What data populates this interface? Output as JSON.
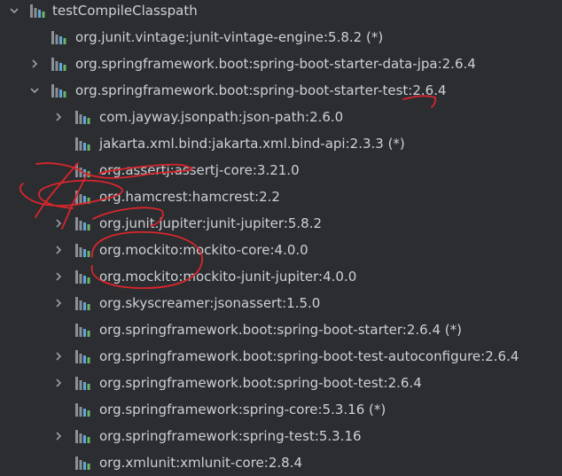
{
  "tree": {
    "root": {
      "label": "testCompileClasspath",
      "icon": "library-icon"
    },
    "items": [
      {
        "label": "org.junit.vintage:junit-vintage-engine:5.8.2 (*)",
        "expandable": false,
        "depth": 1
      },
      {
        "label": "org.springframework.boot:spring-boot-starter-data-jpa:2.6.4",
        "expandable": true,
        "expanded": false,
        "depth": 1
      },
      {
        "label": "org.springframework.boot:spring-boot-starter-test:2.6.4",
        "expandable": true,
        "expanded": true,
        "depth": 1
      },
      {
        "label": "com.jayway.jsonpath:json-path:2.6.0",
        "expandable": true,
        "expanded": false,
        "depth": 2
      },
      {
        "label": "jakarta.xml.bind:jakarta.xml.bind-api:2.3.3 (*)",
        "expandable": false,
        "depth": 2
      },
      {
        "label": "org.assertj:assertj-core:3.21.0",
        "expandable": false,
        "depth": 2
      },
      {
        "label": "org.hamcrest:hamcrest:2.2",
        "expandable": false,
        "depth": 2
      },
      {
        "label": "org.junit.jupiter:junit-jupiter:5.8.2",
        "expandable": true,
        "expanded": false,
        "depth": 2
      },
      {
        "label": "org.mockito:mockito-core:4.0.0",
        "expandable": true,
        "expanded": false,
        "depth": 2
      },
      {
        "label": "org.mockito:mockito-junit-jupiter:4.0.0",
        "expandable": true,
        "expanded": false,
        "depth": 2
      },
      {
        "label": "org.skyscreamer:jsonassert:1.5.0",
        "expandable": true,
        "expanded": false,
        "depth": 2
      },
      {
        "label": "org.springframework.boot:spring-boot-starter:2.6.4 (*)",
        "expandable": false,
        "depth": 2
      },
      {
        "label": "org.springframework.boot:spring-boot-test-autoconfigure:2.6.4",
        "expandable": true,
        "expanded": false,
        "depth": 2
      },
      {
        "label": "org.springframework.boot:spring-boot-test:2.6.4",
        "expandable": true,
        "expanded": false,
        "depth": 2
      },
      {
        "label": "org.springframework:spring-core:5.3.16 (*)",
        "expandable": false,
        "depth": 2
      },
      {
        "label": "org.springframework:spring-test:5.3.16",
        "expandable": true,
        "expanded": false,
        "depth": 2
      },
      {
        "label": "org.xmlunit:xmlunit-core:2.8.4",
        "expandable": false,
        "depth": 2
      }
    ]
  },
  "colors": {
    "background": "#2b2d30",
    "text": "#cdd1d6",
    "chevron": "#9aa0a6",
    "icon_bar_blue": "#5ea7d9",
    "icon_bar_green": "#6bb56b",
    "icon_bar_gray": "#8b9096",
    "annotation_red": "#d8262c"
  }
}
